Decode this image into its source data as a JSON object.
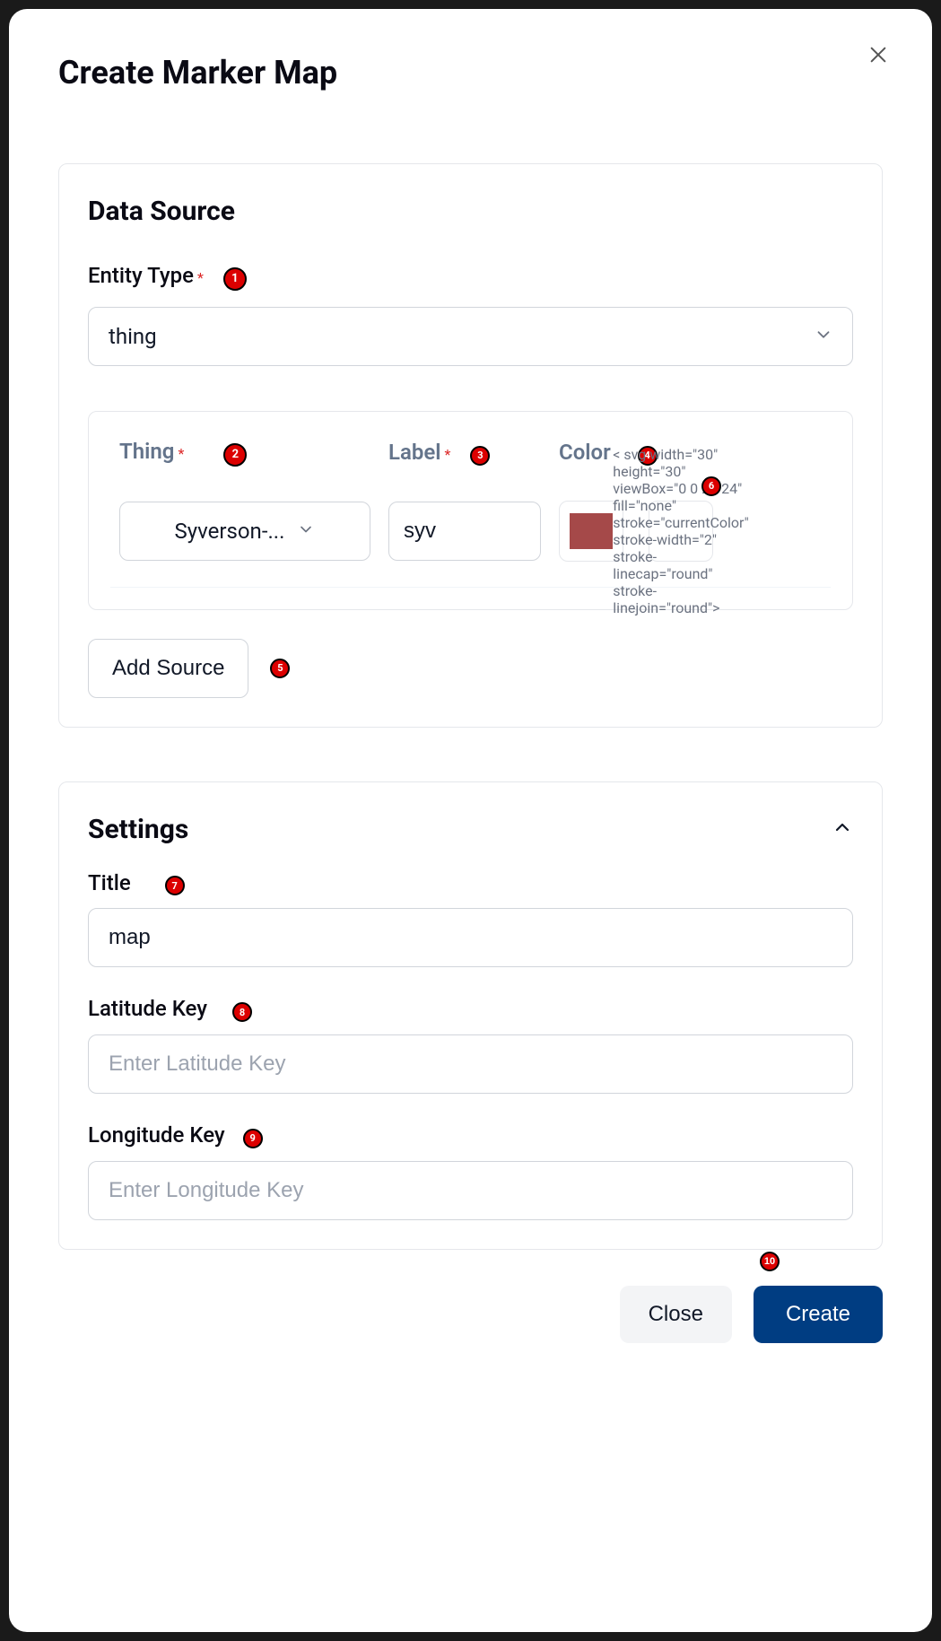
{
  "modal": {
    "title": "Create Marker Map"
  },
  "dataSource": {
    "sectionTitle": "Data Source",
    "entityTypeLabel": "Entity Type",
    "entityTypeValue": "thing",
    "columns": {
      "thing": "Thing",
      "label": "Label",
      "color": "Color"
    },
    "row": {
      "thingValue": "Syverson-...",
      "labelValue": "syv",
      "colorHex": "#a54949"
    },
    "addSourceLabel": "Add Source"
  },
  "settings": {
    "sectionTitle": "Settings",
    "titleLabel": "Title",
    "titleValue": "map",
    "latLabel": "Latitude Key",
    "latPlaceholder": "Enter Latitude Key",
    "lonLabel": "Longitude Key",
    "lonPlaceholder": "Enter Longitude Key"
  },
  "footer": {
    "close": "Close",
    "create": "Create"
  },
  "badges": {
    "b1": "1",
    "b2": "2",
    "b3": "3",
    "b4": "4",
    "b5": "5",
    "b6": "6",
    "b7": "7",
    "b8": "8",
    "b9": "9",
    "b10": "10"
  }
}
